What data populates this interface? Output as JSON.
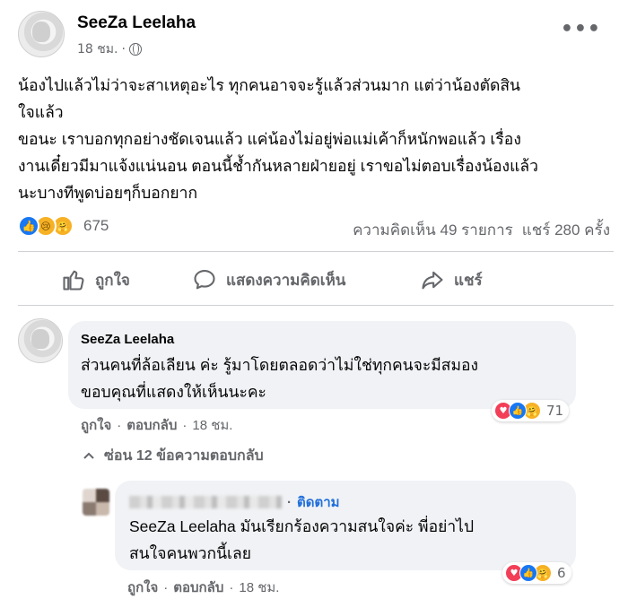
{
  "post": {
    "author": "SeeZa Leelaha",
    "time": "18 ชม.",
    "text": "น้องไปแล้วไม่ว่าจะสาเหตุอะไร ทุกคนอาจจะรู้แล้วส่วนมาก แต่ว่าน้องตัดสิน\nใจแล้ว\nขอนะ เราบอกทุกอย่างชัดเจนแล้ว แค่น้องไม่อยู่พ่อแม่เค้าก็หนักพอแล้ว เรื่อง\nงานเดี๋ยวมีมาแจ้งแน่นอน ตอนนี้ช้ำกันหลายฝ่ายอยู่ เราขอไม่ตอบเรื่องน้องแล้ว\nนะบางทีพูดบ่อยๆก็บอกยาก",
    "reaction_count": "675",
    "comments_count": "ความคิดเห็น 49 รายการ",
    "shares_count": "แชร์ 280 ครั้ง"
  },
  "actions": {
    "like": "ถูกใจ",
    "comment": "แสดงความคิดเห็น",
    "share": "แชร์"
  },
  "comments": [
    {
      "author": "SeeZa Leelaha",
      "text": "ส่วนคนที่ล้อเลียน ค่ะ รู้มาโดยตลอดว่าไม่ใช่ทุกคนจะมีสมอง\nขอบคุณที่แสดงให้เห็นนะคะ",
      "like": "ถูกใจ",
      "reply": "ตอบกลับ",
      "time": "18 ชม.",
      "reactions": "71",
      "hidden_replies": "ซ่อน 12 ข้อความตอบกลับ"
    },
    {
      "follow": "ติดตาม",
      "text": "SeeZa Leelaha มันเรียกร้องความสนใจค่ะ พี่อย่าไป\nสนใจคนพวกนี้เลย",
      "like": "ถูกใจ",
      "reply": "ตอบกลับ",
      "time": "18 ชม.",
      "reactions": "6"
    }
  ],
  "colors": {
    "like_blue": "#1877f2",
    "love_red": "#f33e58",
    "haha_yellow": "#f7b125",
    "link_blue": "#216fdb",
    "muted": "#65676b",
    "bubble": "#f0f2f5"
  },
  "icons": [
    "globe-icon",
    "more-icon",
    "like-icon",
    "comment-icon",
    "share-icon",
    "chevron-up-icon"
  ]
}
